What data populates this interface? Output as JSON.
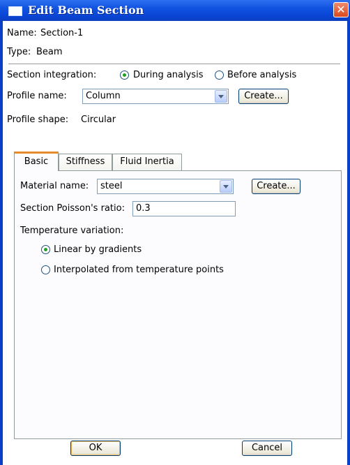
{
  "window": {
    "title": "Edit Beam Section",
    "close_glyph": "✕"
  },
  "section": {
    "name_label": "Name:",
    "name_value": "Section-1",
    "type_label": "Type:",
    "type_value": "Beam"
  },
  "integration": {
    "label": "Section integration:",
    "options": [
      "During analysis",
      "Before analysis"
    ],
    "selected": "During analysis"
  },
  "profile": {
    "name_label": "Profile name:",
    "name_value": "Column",
    "create_label": "Create...",
    "shape_label": "Profile shape:",
    "shape_value": "Circular"
  },
  "tabs": [
    "Basic",
    "Stiffness",
    "Fluid Inertia"
  ],
  "active_tab": "Basic",
  "basic": {
    "material_label": "Material name:",
    "material_value": "steel",
    "create_label": "Create...",
    "poisson_label": "Section Poisson's ratio:",
    "poisson_value": "0.3",
    "temp_label": "Temperature variation:",
    "temp_options": [
      "Linear by gradients",
      "Interpolated from temperature points"
    ],
    "temp_selected": "Linear by gradients"
  },
  "footer": {
    "ok_label": "OK",
    "cancel_label": "Cancel"
  },
  "colors": {
    "titlebar": "#0a45d6",
    "radio_dot": "#21a121",
    "tab_highlight": "#e68b2c"
  }
}
